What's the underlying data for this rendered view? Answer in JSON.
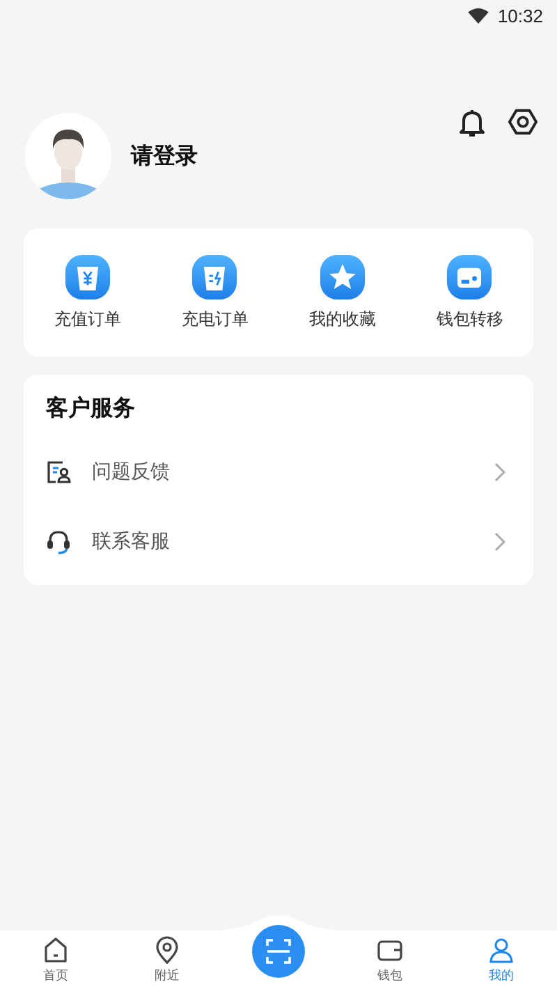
{
  "status_bar": {
    "time": "10:32"
  },
  "profile": {
    "name": "请登录"
  },
  "quick_actions": [
    {
      "kind": "recharge",
      "label": "充值订单"
    },
    {
      "kind": "charge",
      "label": "充电订单"
    },
    {
      "kind": "favorite",
      "label": "我的收藏"
    },
    {
      "kind": "wallet",
      "label": "钱包转移"
    }
  ],
  "service": {
    "title": "客户服务",
    "items": [
      {
        "kind": "feedback",
        "label": "问题反馈"
      },
      {
        "kind": "support",
        "label": "联系客服"
      }
    ]
  },
  "tab_bar": [
    {
      "kind": "home",
      "label": "首页",
      "selected": false
    },
    {
      "kind": "nearby",
      "label": "附近",
      "selected": false
    },
    {
      "kind": "scan",
      "selected": false
    },
    {
      "kind": "wallet",
      "label": "钱包",
      "selected": false
    },
    {
      "kind": "me",
      "label": "我的",
      "selected": true
    }
  ]
}
